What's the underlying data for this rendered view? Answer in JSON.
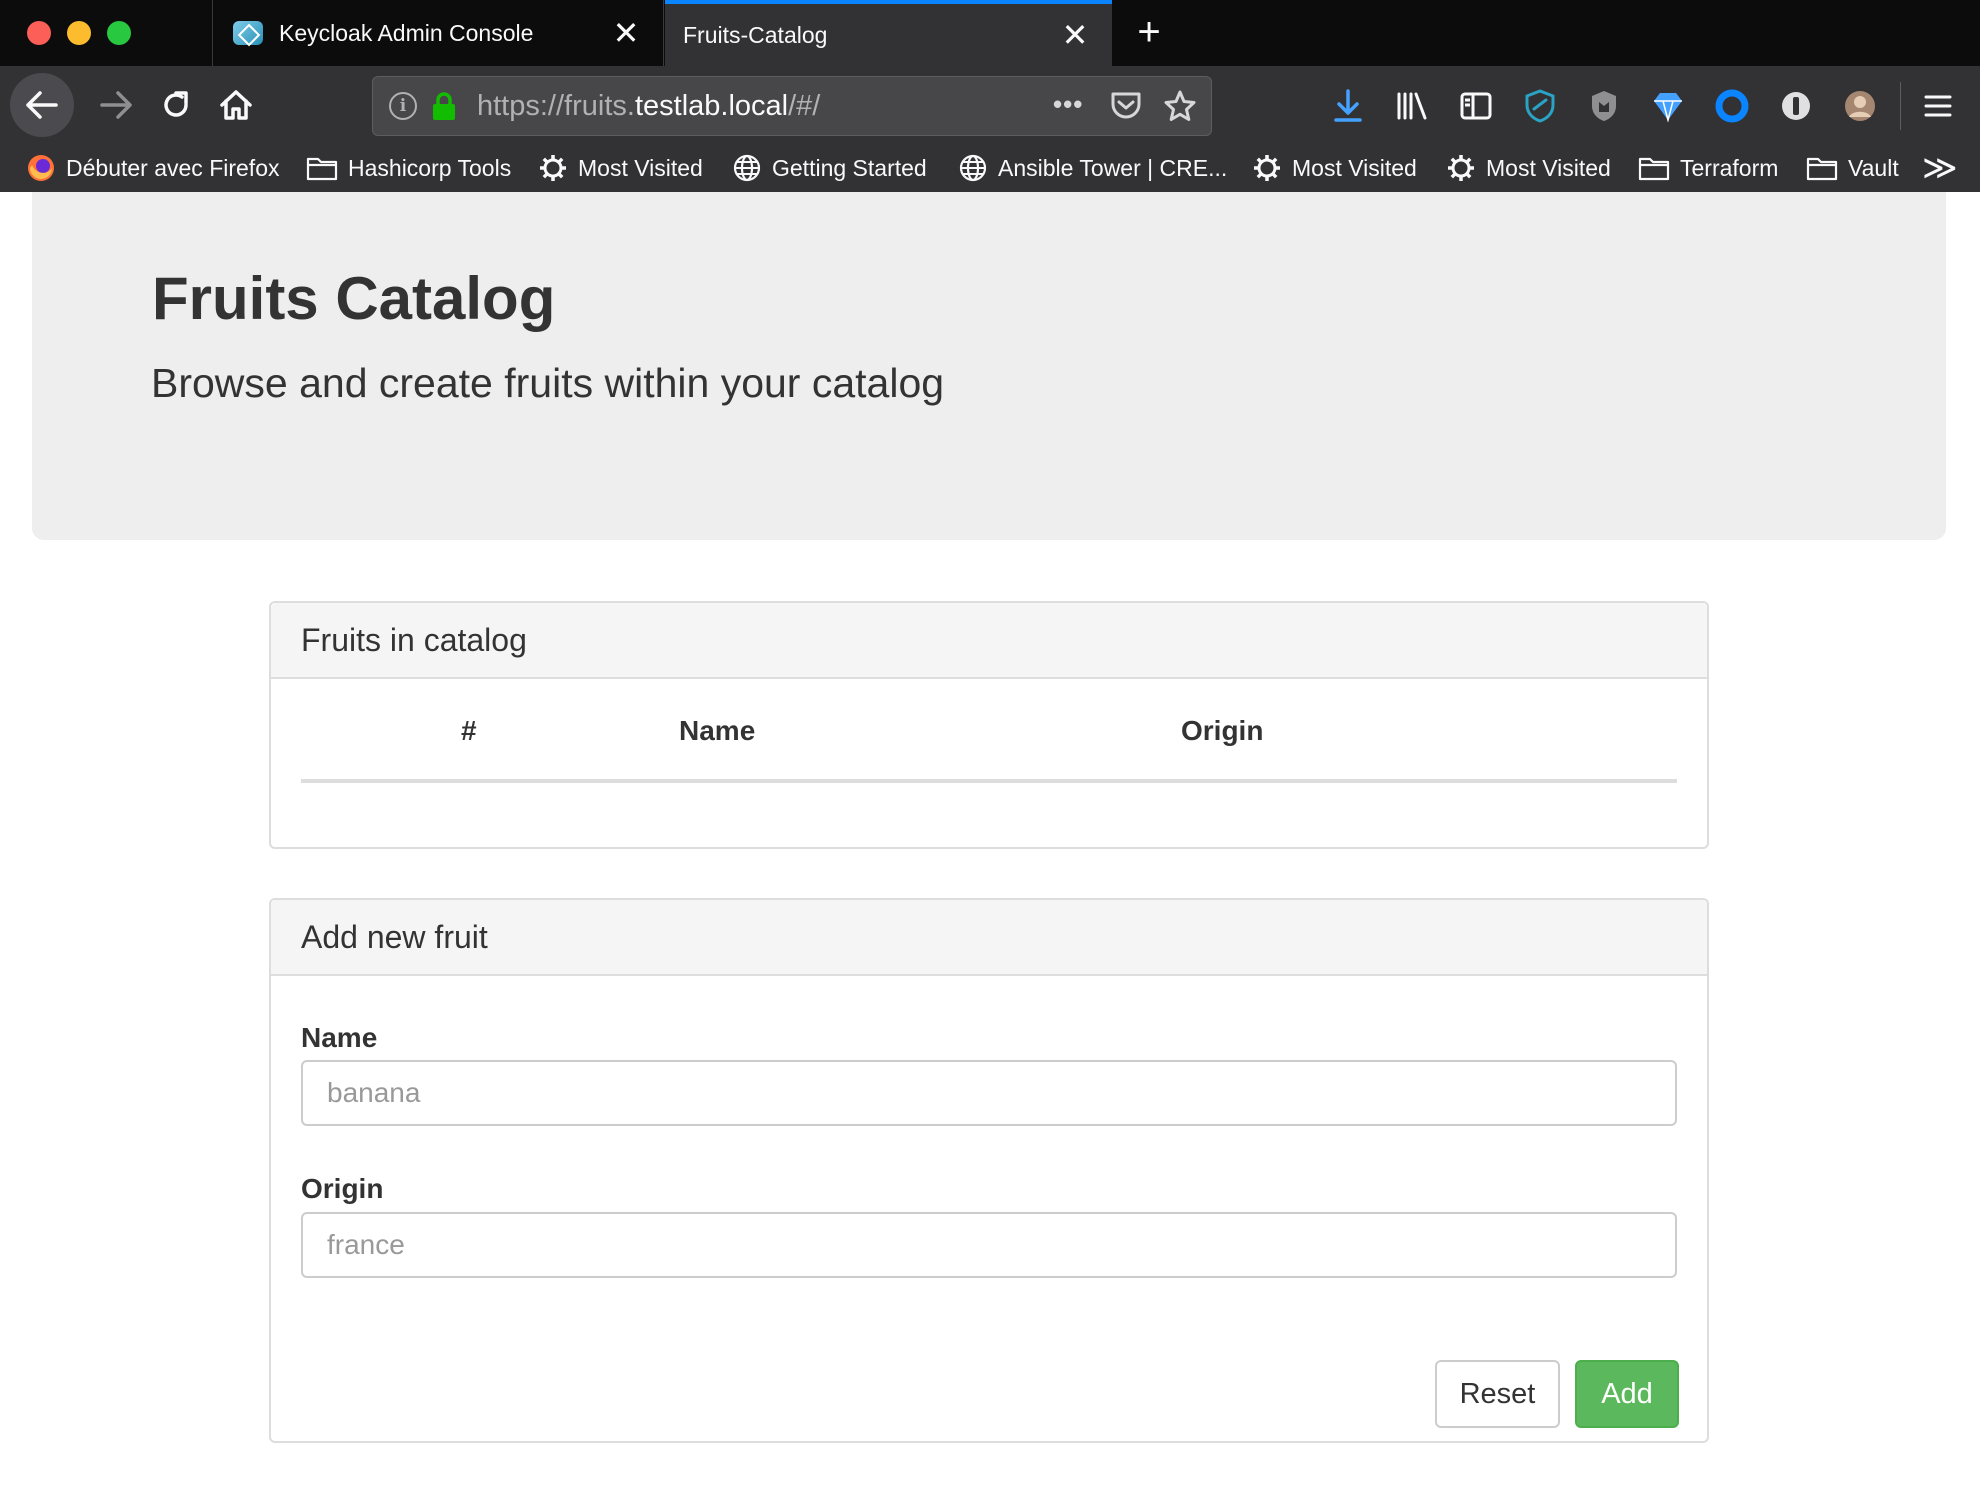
{
  "browser": {
    "tabs": [
      {
        "title": "Keycloak Admin Console",
        "active": false
      },
      {
        "title": "Fruits-Catalog",
        "active": true
      }
    ],
    "new_tab_symbol": "+",
    "close_symbol": "✕",
    "url": {
      "scheme": "https://",
      "host_prefix": "fruits.",
      "host_main": "testlab.local",
      "path": "/#/"
    },
    "url_more_symbol": "•••",
    "bookmarks": [
      {
        "label": "Débuter avec Firefox",
        "icon": "firefox-icon"
      },
      {
        "label": "Hashicorp Tools",
        "icon": "folder-icon"
      },
      {
        "label": "Most Visited",
        "icon": "gear-icon"
      },
      {
        "label": "Getting Started",
        "icon": "globe-icon"
      },
      {
        "label": "Ansible Tower | CRE...",
        "icon": "globe-icon"
      },
      {
        "label": "Most Visited",
        "icon": "gear-icon"
      },
      {
        "label": "Most Visited",
        "icon": "gear-icon"
      },
      {
        "label": "Terraform",
        "icon": "folder-icon"
      },
      {
        "label": "Vault",
        "icon": "folder-icon"
      }
    ],
    "overflow_symbol": "≫",
    "accent_color": "#0a84ff"
  },
  "page": {
    "title": "Fruits Catalog",
    "subtitle": "Browse and create fruits within your catalog",
    "catalog": {
      "heading": "Fruits in catalog",
      "columns": [
        "#",
        "Name",
        "Origin"
      ],
      "rows": []
    },
    "add_form": {
      "heading": "Add new fruit",
      "name_label": "Name",
      "name_placeholder": "banana",
      "origin_label": "Origin",
      "origin_placeholder": "france",
      "reset_label": "Reset",
      "add_label": "Add",
      "add_color": "#5cb85c"
    }
  }
}
